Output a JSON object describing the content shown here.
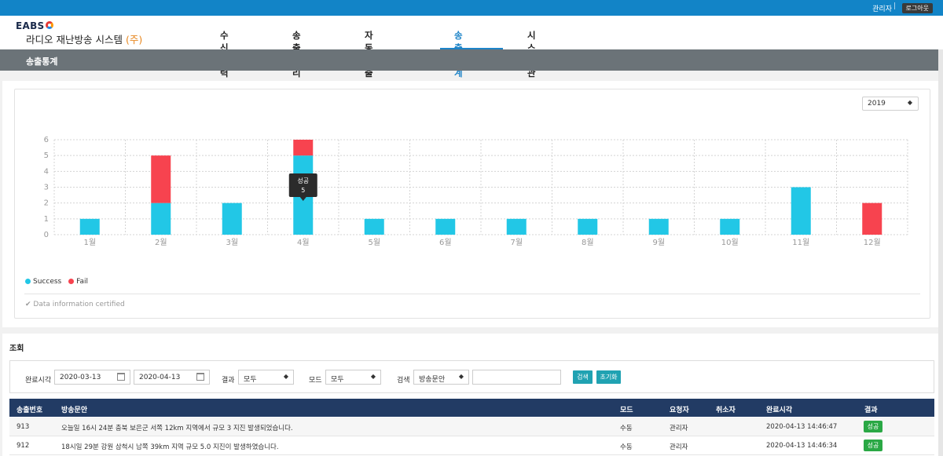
{
  "topbar": {
    "user": "관리자",
    "separator": "|",
    "logout": "로그아웃"
  },
  "logo": {
    "brand": "EABS",
    "subtitle": "라디오 재난방송 시스템",
    "corp": "(주)"
  },
  "nav": [
    {
      "label": "수신이력"
    },
    {
      "label": "송출관리"
    },
    {
      "label": "자동송출일정"
    },
    {
      "label": "송출통계"
    },
    {
      "label": "시스템관리"
    }
  ],
  "page_title": "송출통계",
  "year_select": "2019",
  "chart_data": {
    "type": "bar",
    "stacked": true,
    "categories": [
      "1월",
      "2월",
      "3월",
      "4월",
      "5월",
      "6월",
      "7월",
      "8월",
      "9월",
      "10월",
      "11월",
      "12월"
    ],
    "series": [
      {
        "name": "Success",
        "color": "#22c7e6",
        "values": [
          1,
          2,
          2,
          5,
          1,
          1,
          1,
          1,
          1,
          1,
          3,
          0
        ]
      },
      {
        "name": "Fail",
        "color": "#f7434f",
        "values": [
          0,
          3,
          0,
          1,
          0,
          0,
          0,
          0,
          0,
          0,
          0,
          2
        ]
      }
    ],
    "ylim": [
      0,
      6
    ],
    "yticks": [
      0,
      1,
      2,
      3,
      4,
      5,
      6
    ],
    "grid": true,
    "legend": "bottom-left",
    "tooltip": {
      "category": "4월",
      "label": "성공",
      "value": "5"
    }
  },
  "legend_items": [
    {
      "label": "Success",
      "color": "#22c7e6"
    },
    {
      "label": "Fail",
      "color": "#f7434f"
    }
  ],
  "certified": "Data information certified",
  "search": {
    "title": "조회",
    "complete_label": "완료시각",
    "date_from": "2020-03-13",
    "date_to": "2020-04-13",
    "result_label": "결과",
    "result_value": "모두",
    "mode_label": "모드",
    "mode_value": "모두",
    "search_label": "검색",
    "search_field": "방송문안",
    "search_button": "검색",
    "reset_button": "초기화"
  },
  "table": {
    "headers": [
      "송출번호",
      "방송문안",
      "모드",
      "요청자",
      "취소자",
      "완료시각",
      "결과"
    ],
    "rows": [
      {
        "id": "913",
        "text": "오늘일 16시 24분 충북 보은군 서쪽 12km 지역에서 규모 3 지진 발생되었습니다.",
        "mode": "수동",
        "requester": "관리자",
        "canceler": "",
        "completed": "2020-04-13 14:46:47",
        "result": "성공"
      },
      {
        "id": "912",
        "text": "18시일 29분 강원 삼척시 남쪽 39km 지역 규모 5.0 지진이 발생하였습니다.",
        "mode": "수동",
        "requester": "관리자",
        "canceler": "",
        "completed": "2020-04-13 14:46:34",
        "result": "성공"
      }
    ]
  }
}
